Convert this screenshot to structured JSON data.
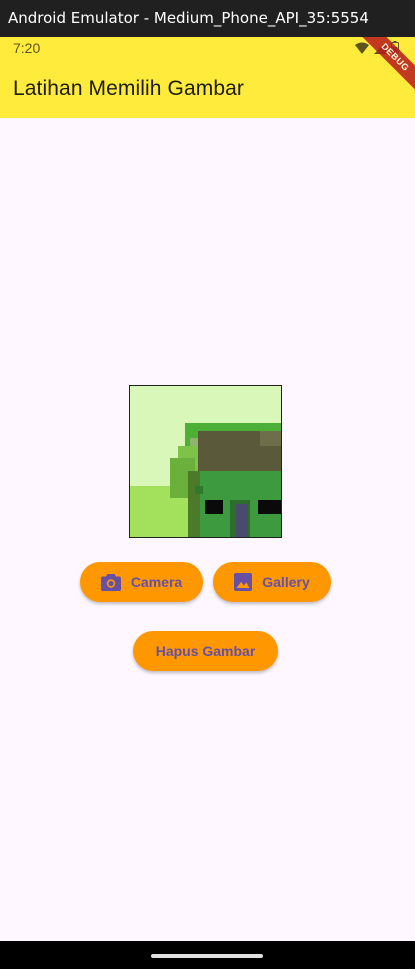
{
  "window": {
    "title": "Android Emulator - Medium_Phone_API_35:5554"
  },
  "status_bar": {
    "time": "7:20",
    "icons": [
      "wifi-icon",
      "signal-icon",
      "battery-icon"
    ]
  },
  "app_bar": {
    "title": "Latihan Memilih Gambar",
    "background": "#ffeb3b"
  },
  "debug_banner": {
    "label": "DEBUG"
  },
  "image_preview": {
    "description_icon": "image-preview"
  },
  "buttons": {
    "camera": {
      "label": "Camera",
      "icon": "camera-icon"
    },
    "gallery": {
      "label": "Gallery",
      "icon": "image-icon"
    },
    "hapus": {
      "label": "Hapus Gambar"
    }
  },
  "colors": {
    "button_bg": "#ff9800",
    "button_text": "#6750a4",
    "page_bg": "#fef7ff"
  }
}
